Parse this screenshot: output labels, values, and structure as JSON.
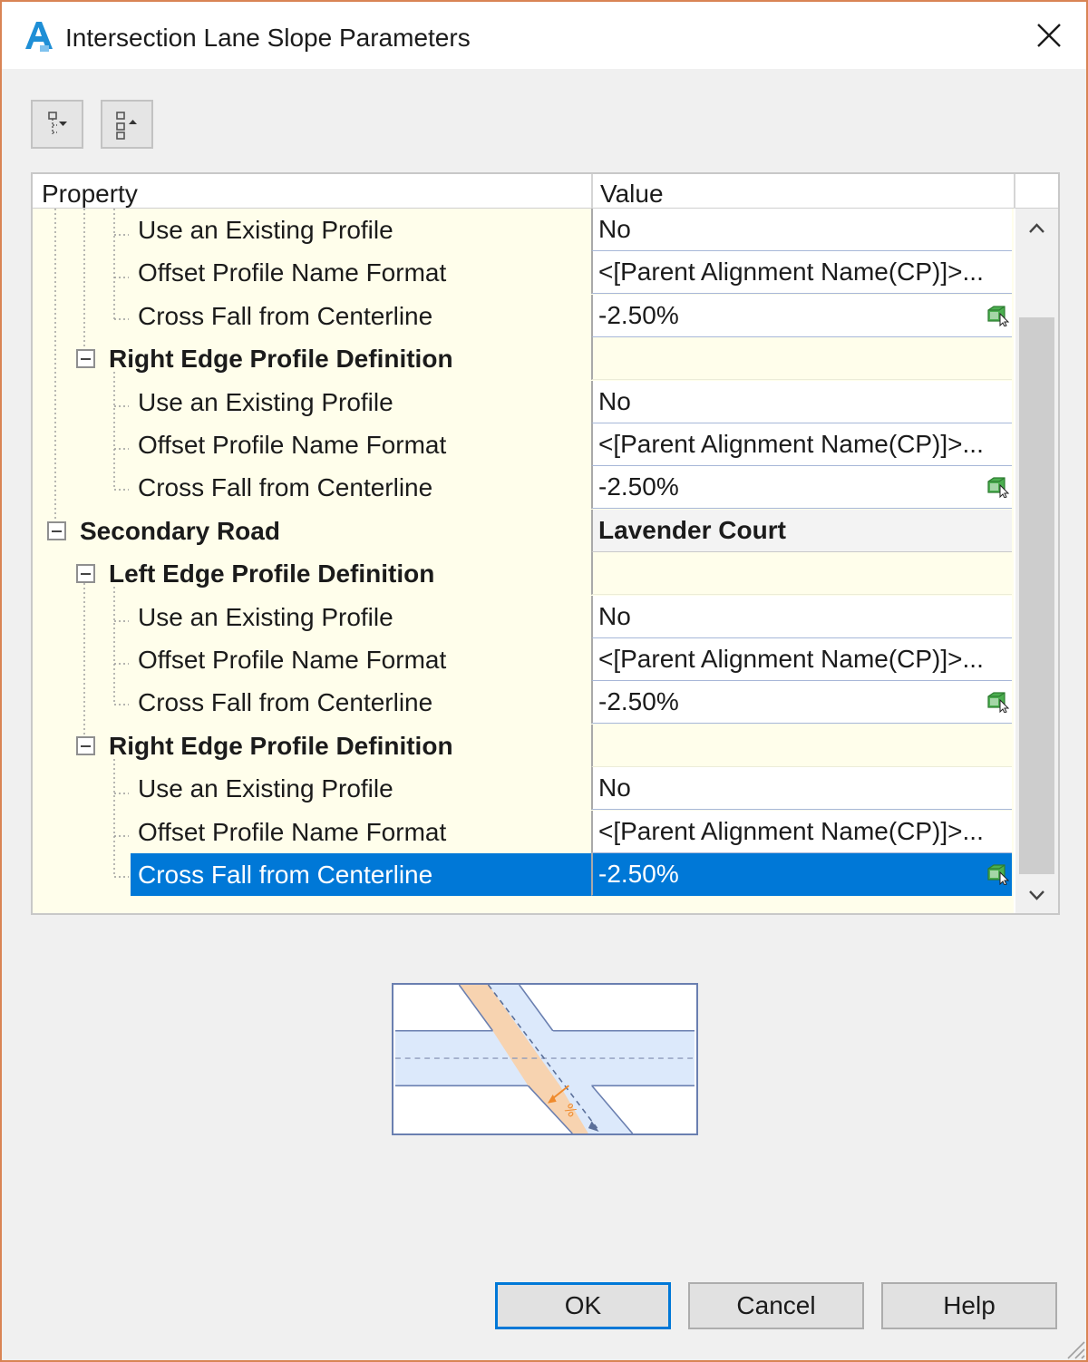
{
  "window": {
    "title": "Intersection Lane Slope Parameters",
    "app_icon": "autocad-civil3d-icon",
    "close_icon": "close-icon",
    "border_color": "#d98454"
  },
  "toolbar": {
    "buttons": [
      {
        "name": "categorized-view-button",
        "icon": "expand-all-icon"
      },
      {
        "name": "alphabetic-view-button",
        "icon": "collapse-all-icon"
      }
    ]
  },
  "grid": {
    "columns": {
      "property": "Property",
      "value": "Value"
    },
    "rows": [
      {
        "label": "Use an Existing Profile",
        "value": "No",
        "level": 2,
        "type": "item"
      },
      {
        "label": "Offset Profile Name Format",
        "value": "<[Parent Alignment Name(CP)]>...",
        "level": 2,
        "type": "item"
      },
      {
        "label": "Cross Fall from Centerline",
        "value": "-2.50%",
        "level": 2,
        "type": "item",
        "editable_icon": true
      },
      {
        "label": "Right Edge Profile Definition",
        "value": "",
        "level": 1,
        "type": "category"
      },
      {
        "label": "Use an Existing Profile",
        "value": "No",
        "level": 2,
        "type": "item"
      },
      {
        "label": "Offset Profile Name Format",
        "value": "<[Parent Alignment Name(CP)]>...",
        "level": 2,
        "type": "item"
      },
      {
        "label": "Cross Fall from Centerline",
        "value": "-2.50%",
        "level": 2,
        "type": "item",
        "editable_icon": true
      },
      {
        "label": "Secondary Road",
        "value": "Lavender Court",
        "level": 0,
        "type": "road"
      },
      {
        "label": "Left Edge Profile Definition",
        "value": "",
        "level": 1,
        "type": "category"
      },
      {
        "label": "Use an Existing Profile",
        "value": "No",
        "level": 2,
        "type": "item"
      },
      {
        "label": "Offset Profile Name Format",
        "value": "<[Parent Alignment Name(CP)]>...",
        "level": 2,
        "type": "item"
      },
      {
        "label": "Cross Fall from Centerline",
        "value": "-2.50%",
        "level": 2,
        "type": "item",
        "editable_icon": true
      },
      {
        "label": "Right Edge Profile Definition",
        "value": "",
        "level": 1,
        "type": "category"
      },
      {
        "label": "Use an Existing Profile",
        "value": "No",
        "level": 2,
        "type": "item"
      },
      {
        "label": "Offset Profile Name Format",
        "value": "<[Parent Alignment Name(CP)]>...",
        "level": 2,
        "type": "item"
      },
      {
        "label": "Cross Fall from Centerline",
        "value": "-2.50%",
        "level": 2,
        "type": "item",
        "editable_icon": true,
        "selected": true
      }
    ],
    "selection_color": "#0078d7",
    "category_bg": "#fffeeb"
  },
  "preview": {
    "icon": "intersection-cross-fall-diagram",
    "symbol": "%"
  },
  "buttons": {
    "ok": "OK",
    "cancel": "Cancel",
    "help": "Help"
  }
}
